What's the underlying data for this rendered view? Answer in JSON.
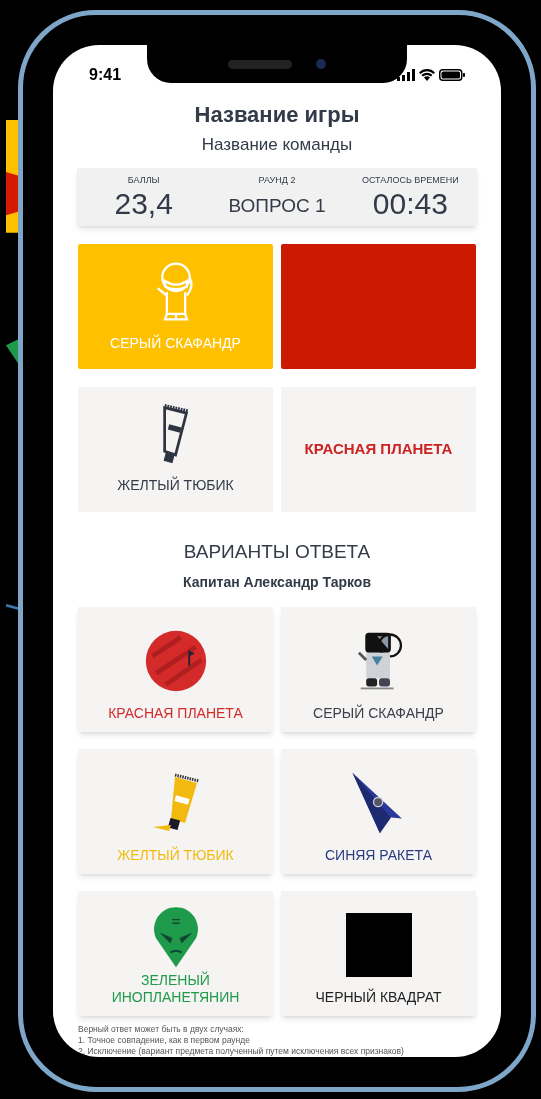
{
  "status_bar": {
    "time": "9:41"
  },
  "title": "Название игры",
  "subtitle": "Название команды",
  "stats": [
    {
      "label": "БАЛЛЫ",
      "value": "23,4",
      "kind": "big"
    },
    {
      "label": "РАУНД 2",
      "value": "ВОПРОС 1",
      "kind": "small"
    },
    {
      "label": "ОСТАЛОСЬ ВРЕМЕНИ",
      "value": "00:43",
      "kind": "big"
    }
  ],
  "slots": [
    {
      "label": "СЕРЫЙ СКАФАНДР",
      "kind": "astronaut",
      "color": "#ffc000"
    },
    {
      "kind": "color",
      "color": "#cc1a00"
    },
    {
      "label": "ЖЕЛТЫЙ ТЮБИК",
      "kind": "tube"
    },
    {
      "label": "КРАСНАЯ ПЛАНЕТА",
      "kind": "label",
      "color": "#cc2222"
    }
  ],
  "answers_heading": "ВАРИАНТЫ ОТВЕТА",
  "answers_subheading": "Капитан Александр Тарков",
  "answers": [
    {
      "label": "КРАСНАЯ ПЛАНЕТА",
      "kind": "planet",
      "color": "#d42a2a"
    },
    {
      "label": "СЕРЫЙ СКАФАНДР",
      "kind": "astronaut",
      "color": "#3a3f4a"
    },
    {
      "label": "ЖЕЛТЫЙ ТЮБИК",
      "kind": "tube",
      "color": "#f2b90f"
    },
    {
      "label": "СИНЯЯ РАКЕТА",
      "kind": "rocket",
      "color": "#2a3a80"
    },
    {
      "label": "ЗЕЛЕНЫЙ ИНОПЛАНЕТЯНИН",
      "kind": "alien",
      "color": "#1f9a4a"
    },
    {
      "label": "ЧЕРНЫЙ КВАДРАТ",
      "kind": "square",
      "color": "#222222"
    }
  ],
  "footnote": [
    "Верный ответ может быть в двух случаях:",
    "1. Точное совпадение, как в первом раунде",
    "2. Исключение (вариант предмета полученный путем исключения всех признаков)"
  ]
}
